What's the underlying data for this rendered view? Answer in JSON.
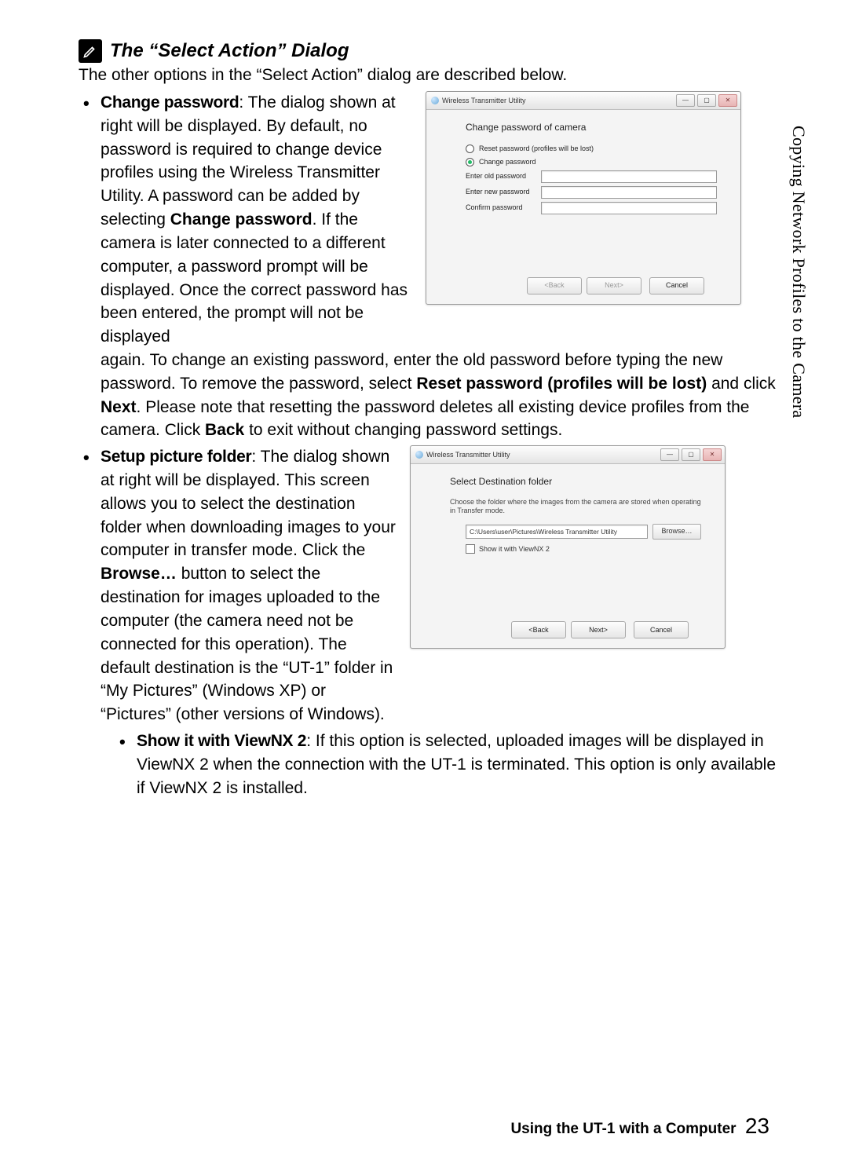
{
  "side_tab": "Copying Network Profiles to the Camera",
  "section_title": "The “Select Action” Dialog",
  "intro": "The other options in the “Select Action” dialog are described below.",
  "bullets": {
    "change_password": {
      "label": "Change password",
      "narrow": ": The dialog shown at right will be displayed. By default, no password is required to change device profiles using the Wireless Transmitter Utility. A password can be added by selecting ",
      "bold_inline": "Change password",
      "narrow_cont": ". If the camera is later connected to a different computer, a password prompt will be displayed. Once the correct password has been entered, the prompt will not be displayed ",
      "wide": "again. To change an existing password, enter the old password before typing the new password. To remove the password, select ",
      "bold_reset": "Reset password (profiles will be lost)",
      "wide_cont1": " and click ",
      "bold_next": "Next",
      "wide_cont2": ". Please note that resetting the password deletes all existing device profiles from the camera. Click ",
      "bold_back": "Back",
      "wide_cont3": " to exit without changing password settings."
    },
    "setup_folder": {
      "label": "Setup picture folder",
      "narrow": ": The dialog shown at right will be displayed. This screen allows you to select the destination folder when downloading images to your computer in transfer mode. Click the ",
      "bold_browse": "Browse…",
      "narrow_cont": " button to select the destination for images uploaded to the computer (the camera need not be connected for this operation). The default destination is the “UT-1” folder in “My Pictures” (Windows XP) or “Pictures” (other versions of Windows)."
    },
    "viewnx": {
      "label": "Show it with ViewNX 2",
      "text": ": If this option is selected, uploaded images will be displayed in ViewNX 2 when the connection with the UT-1 is terminated. This option is only available if ViewNX 2 is installed."
    }
  },
  "dialog1": {
    "title": "Wireless Transmitter Utility",
    "heading": "Change password of camera",
    "radio_reset": "Reset password (profiles will be lost)",
    "radio_change": "Change password",
    "lbl_old": "Enter old password",
    "lbl_new": "Enter new password",
    "lbl_confirm": "Confirm password",
    "btn_back": "<Back",
    "btn_next": "Next>",
    "btn_cancel": "Cancel"
  },
  "dialog2": {
    "title": "Wireless Transmitter Utility",
    "heading": "Select Destination folder",
    "desc": "Choose the folder where the images from the camera are stored when operating in Transfer mode.",
    "path": "C:\\Users\\user\\Pictures\\Wireless Transmitter Utility",
    "browse": "Browse…",
    "chk": "Show it with ViewNX 2",
    "btn_back": "<Back",
    "btn_next": "Next>",
    "btn_cancel": "Cancel"
  },
  "footer": {
    "text": "Using the UT-1 with a Computer",
    "page": "23"
  }
}
